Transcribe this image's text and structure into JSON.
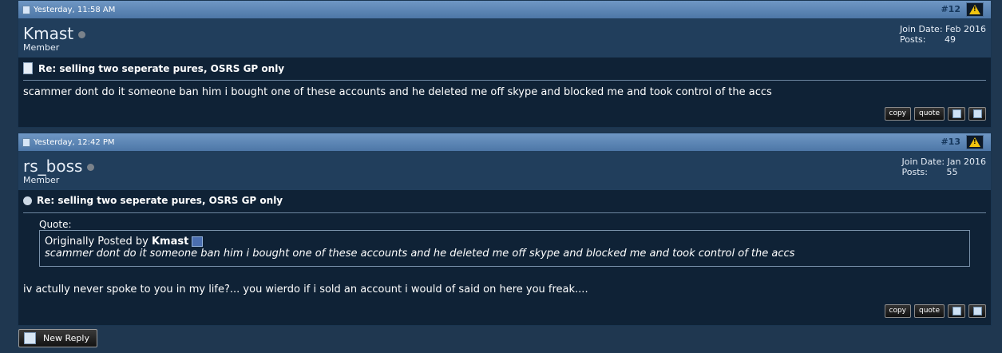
{
  "posts": [
    {
      "date": "Yesterday, 11:58 AM",
      "number": "#12",
      "username": "Kmast",
      "user_title": "Member",
      "join_label": "Join Date:",
      "join_date": "Feb 2016",
      "posts_label": "Posts:",
      "post_count": "49",
      "title": "Re: selling two seperate pures, OSRS GP only",
      "body": "scammer dont do it someone ban him i bought one of these accounts and he deleted me off skype and blocked me and took control of the accs",
      "buttons": {
        "copy": "copy",
        "quote": "quote"
      }
    },
    {
      "date": "Yesterday, 12:42 PM",
      "number": "#13",
      "username": "rs_boss",
      "user_title": "Member",
      "join_label": "Join Date:",
      "join_date": "Jan 2016",
      "posts_label": "Posts:",
      "post_count": "55",
      "title": "Re: selling two seperate pures, OSRS GP only",
      "quote_label": "Quote:",
      "quote_prefix": "Originally Posted by",
      "quote_author": "Kmast",
      "quote_text": "scammer dont do it someone ban him i bought one of these accounts and he deleted me off skype and blocked me and took control of the accs",
      "body": "iv actully never spoke to you in my life?... you wierdo if i sold an account i would of said on here you freak....",
      "buttons": {
        "copy": "copy",
        "quote": "quote"
      }
    }
  ],
  "new_reply_label": "New Reply",
  "icons": [
    "post-icon",
    "warning-icon",
    "status-offline-icon",
    "document-icon",
    "reply-icon",
    "view-post-icon",
    "multi-quote-icon",
    "edit-icon",
    "pencil-icon"
  ],
  "colors": {
    "header_blue": "#5b84b4",
    "background": "#1f3750",
    "post_body": "#0f2236",
    "warning_yellow": "#f1c40f"
  }
}
